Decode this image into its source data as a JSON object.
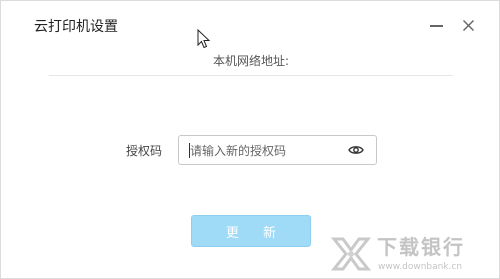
{
  "window": {
    "title": "云打印机设置",
    "controls": {
      "minimize_icon": "minimize-icon",
      "close_icon": "close-icon"
    }
  },
  "address": {
    "label": "本机网络地址:"
  },
  "auth": {
    "label": "授权码",
    "placeholder": "请输入新的授权码",
    "value": "",
    "toggle_icon": "eye-icon"
  },
  "actions": {
    "update_label": "更 新"
  },
  "watermark": {
    "brand": "下载银行",
    "url": "www.downbank.cn"
  },
  "colors": {
    "button_bg": "#9fdaf7",
    "button_text": "#ffffff",
    "title_text": "#222222",
    "watermark": "#c4c4c4"
  }
}
